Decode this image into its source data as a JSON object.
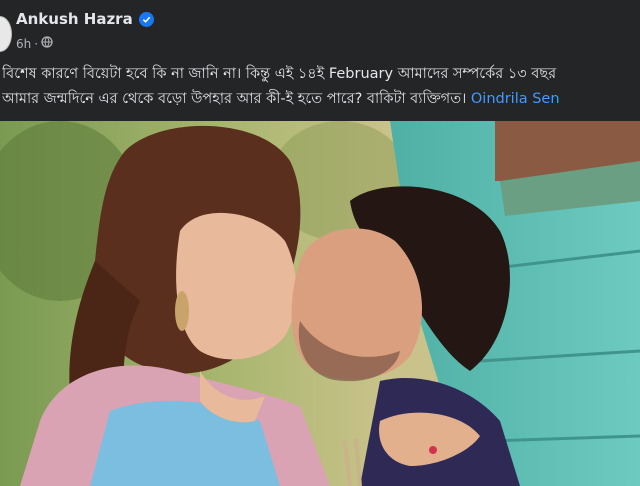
{
  "post": {
    "author": "Ankush Hazra",
    "time": "6h",
    "dot": "·",
    "text_line1": "বিশেষ কারণে বিয়েটা হবে কি না জানি না। কিন্তু এই ১৪ই February আমাদের সম্পর্কের ১৩ বছর",
    "text_line2": "আমার জন্মদিনে এর থেকে বড়ো উপহার আর কী-ই হতে পারে? বাকিটা ব্যক্তিগত।",
    "mention": "Oindrila Sen"
  },
  "icons": {
    "verified": "verified-badge-icon",
    "audience": "globe-icon"
  },
  "colors": {
    "background": "#242526",
    "link": "#4599ff",
    "verified": "#1877f2",
    "wall": "#5bbfb3"
  }
}
